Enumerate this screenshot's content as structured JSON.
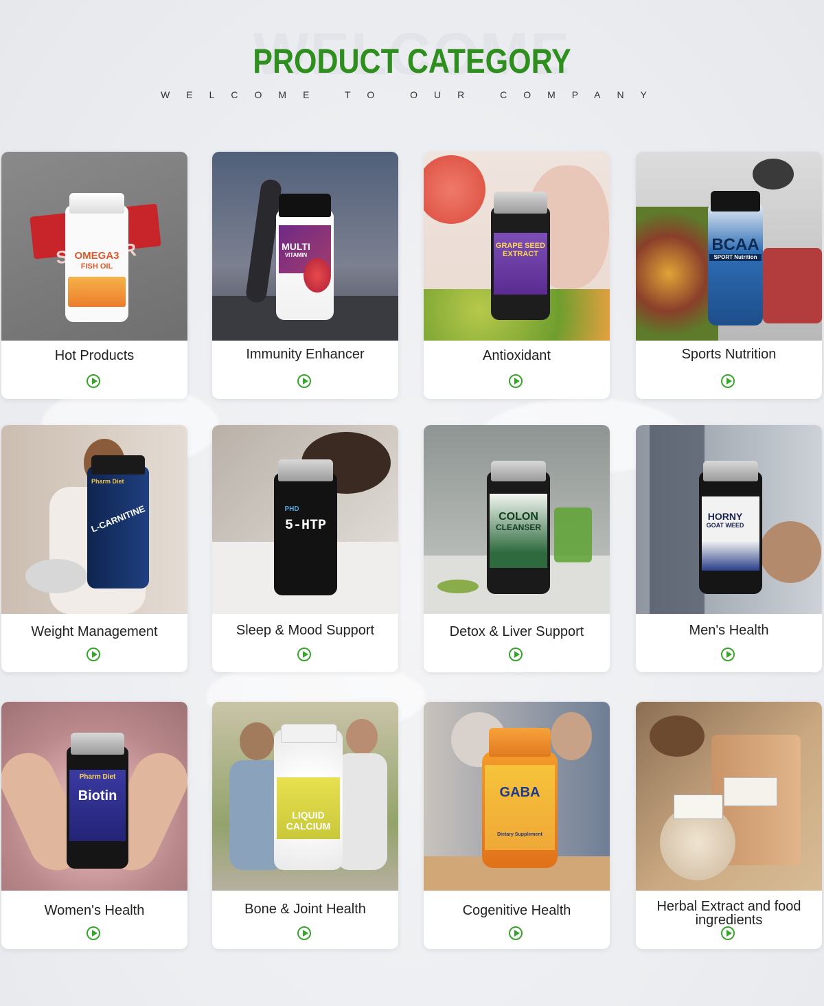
{
  "header": {
    "watermark": "WELCOME",
    "title": "PRODUCT CATEGORY",
    "subtitle": "WELCOME TO OUR COMPANY"
  },
  "categories": [
    {
      "label": "Hot Products",
      "product": "OMEGA3",
      "product_sub": "FISH OIL",
      "banner": "BEST SELLER"
    },
    {
      "label": "Immunity Enhancer",
      "product": "MULTI",
      "product_sub": "VITAMIN"
    },
    {
      "label": "Antioxidant",
      "product": "GRAPE SEED",
      "product_sub": "EXTRACT"
    },
    {
      "label": "Sports Nutrition",
      "product": "BCAA",
      "product_sub": "SPORT Nutrition"
    },
    {
      "label": "Weight Management",
      "product": "L-CARNITINE",
      "product_sub": "Pharm Diet"
    },
    {
      "label": "Sleep & Mood Support",
      "product": "5-HTP",
      "product_sub": "PHD"
    },
    {
      "label": "Detox & Liver Support",
      "product": "COLON",
      "product_sub": "CLEANSER"
    },
    {
      "label": "Men's Health",
      "product": "HORNY",
      "product_sub": "GOAT WEED"
    },
    {
      "label": "Women's Health",
      "product": "Biotin",
      "product_sub": "Pharm Diet"
    },
    {
      "label": "Bone & Joint Health",
      "product": "LIQUID",
      "product_sub": "CALCIUM"
    },
    {
      "label": "Cogenitive Health",
      "product": "GABA",
      "product_sub": "Dietary Supplement"
    },
    {
      "label": "Herbal Extract and food ingredients",
      "product": "",
      "product_sub": ""
    }
  ],
  "colors": {
    "title_green": "#2f8f1e",
    "arrow_green": "#37a52a",
    "card_bg": "#ffffff"
  },
  "icons": {
    "go": "arrow-circle-right-icon"
  }
}
